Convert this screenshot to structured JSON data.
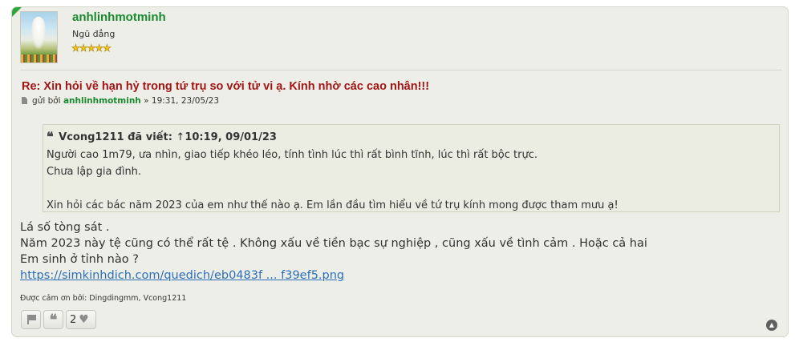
{
  "author": {
    "username": "anhlinhmotminh",
    "rank": "Ngũ đẳng",
    "stars": "★★★★★",
    "star_count": 5
  },
  "post": {
    "title": "Re: Xin hỏi về hạn hỷ trong tứ trụ so với tử vi ạ. Kính nhờ các cao nhân!!!",
    "meta_prefix": "gửi bởi",
    "meta_author": "anhlinhmotminh",
    "meta_suffix": "» 19:31, 23/05/23"
  },
  "quote": {
    "icon": "❝",
    "author": "Vcong1211",
    "wrote": "đã viết:",
    "up_arrow": "↑",
    "time": "10:19, 09/01/23",
    "lines": [
      "Người cao 1m79, ưa nhìn, giao tiếp khéo léo, tính tình lúc thì rất bình tĩnh, lúc thì rất bộc trực.",
      "Chưa lập gia đình.",
      "",
      "Xin hỏi các bác năm 2023 của em như thế nào ạ. Em lần đầu tìm hiểu về tứ trụ kính mong được tham mưu ạ!"
    ]
  },
  "content": {
    "lines": [
      "Lá số tòng sát .",
      "Năm 2023 này tệ cũng có thể rất tệ . Không xấu về tiền bạc sự nghiệp , cũng xấu về tình cảm . Hoặc cả hai",
      "Em sinh ở tỉnh nào ?"
    ],
    "link": "https://simkinhdich.com/quedich/eb0483f ... f39ef5.png"
  },
  "thanks": "Được cảm ơn bởi: Dingdingmm, Vcong1211",
  "actions": {
    "like_count": "2",
    "flag_icon": "flag-icon",
    "quote_icon": "quote-icon",
    "like_icon": "heart-icon",
    "top_icon": "arrow-up-circle-icon"
  },
  "colors": {
    "username": "#1a8a30",
    "title": "#a31616",
    "link": "#2d6fb6",
    "post_bg": "#eeeee8",
    "quote_bg": "#ebece2"
  }
}
